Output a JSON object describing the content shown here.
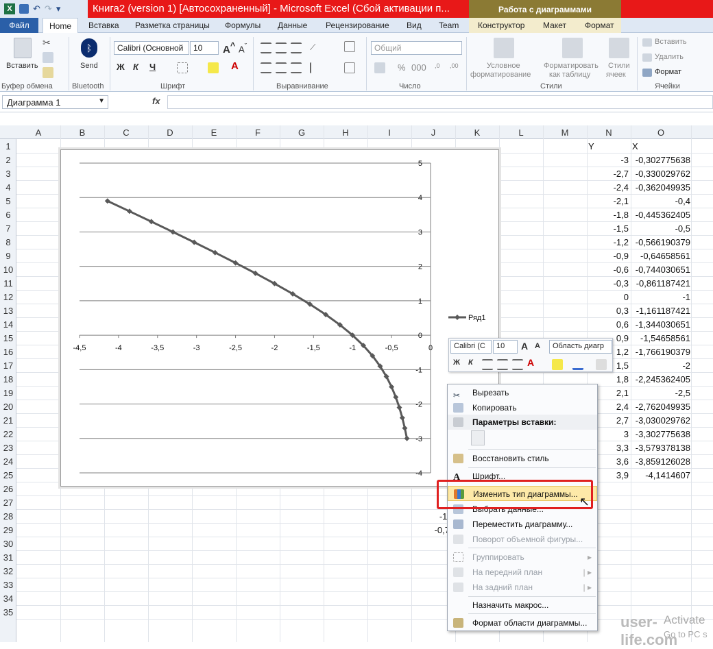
{
  "window": {
    "title": "Книга2 (version 1) [Автосохраненный]  -  Microsoft Excel (Сбой активации п...",
    "context_tab_title": "Работа с диаграммами"
  },
  "tabs": [
    {
      "label": "Файл"
    },
    {
      "label": "Home"
    },
    {
      "label": "Вставка"
    },
    {
      "label": "Разметка страницы"
    },
    {
      "label": "Формулы"
    },
    {
      "label": "Данные"
    },
    {
      "label": "Рецензирование"
    },
    {
      "label": "Вид"
    },
    {
      "label": "Team"
    },
    {
      "label": "Конструктор"
    },
    {
      "label": "Макет"
    },
    {
      "label": "Формат"
    }
  ],
  "ribbon": {
    "paste_label": "Вставить",
    "send_label": "Send",
    "font_name": "Calibri (Основной",
    "font_size": "10",
    "number_format": "Общий",
    "cond_format_line1": "Условное",
    "cond_format_line2": "форматирование",
    "table_format_line1": "Форматировать",
    "table_format_line2": "как таблицу",
    "cell_styles_line1": "Стили",
    "cell_styles_line2": "ячеек",
    "insert_label": "Вставить",
    "delete_label": "Удалить",
    "format_label": "Формат",
    "groups": {
      "clipboard": "Буфер обмена",
      "bluetooth": "Bluetooth",
      "font": "Шрифт",
      "alignment": "Выравнивание",
      "number": "Число",
      "styles": "Стили",
      "cells": "Ячейки"
    }
  },
  "formula_bar": {
    "name_box": "Диаграмма 1",
    "fx": "fx"
  },
  "columns": [
    "A",
    "B",
    "C",
    "D",
    "E",
    "F",
    "G",
    "H",
    "I",
    "J",
    "K",
    "L",
    "M",
    "N",
    "O"
  ],
  "rows": [
    "1",
    "2",
    "3",
    "4",
    "5",
    "6",
    "7",
    "8",
    "9",
    "10",
    "11",
    "12",
    "13",
    "14",
    "15",
    "16",
    "17",
    "18",
    "19",
    "20",
    "21",
    "22",
    "23",
    "24",
    "25",
    "26",
    "27",
    "28",
    "29",
    "30",
    "31",
    "32",
    "33",
    "34",
    "35"
  ],
  "sheet": {
    "header_y": "Y",
    "header_x": "X",
    "y_values": [
      "-3",
      "-2,7",
      "-2,4",
      "-2,1",
      "-1,8",
      "-1,5",
      "-1,2",
      "-0,9",
      "-0,6",
      "-0,3",
      "0",
      "0,3",
      "0,6",
      "0,9",
      "1,2",
      "1,5",
      "1,8",
      "2,1",
      "2,4",
      "2,7",
      "3",
      "3,3",
      "3,6",
      "3,9"
    ],
    "x_values": [
      "-0,302775638",
      "-0,330029762",
      "-0,362049935",
      "-0,4",
      "-0,445362405",
      "-0,5",
      "-0,566190379",
      "-0,64658561",
      "-0,744030651",
      "-0,861187421",
      "-1",
      "-1,161187421",
      "-1,344030651",
      "-1,54658561",
      "-1,766190379",
      "-2",
      "-2,245362405",
      "-2,5",
      "-2,762049935",
      "-3,030029762",
      "-3,302775638",
      "-3,579378138",
      "-3,859126028",
      "-4,1414607"
    ],
    "partial_cells": [
      "-1,",
      "-0,7"
    ]
  },
  "chart_data": {
    "type": "scatter",
    "series": [
      {
        "name": "Ряд1",
        "x": [
          -0.302775638,
          -0.330029762,
          -0.362049935,
          -0.4,
          -0.445362405,
          -0.5,
          -0.566190379,
          -0.64658561,
          -0.744030651,
          -0.861187421,
          -1,
          -1.161187421,
          -1.344030651,
          -1.54658561,
          -1.766190379,
          -2,
          -2.245362405,
          -2.5,
          -2.762049935,
          -3.030029762,
          -3.302775638,
          -3.579378138,
          -3.859126028,
          -4.1414607
        ],
        "y": [
          -3,
          -2.7,
          -2.4,
          -2.1,
          -1.8,
          -1.5,
          -1.2,
          -0.9,
          -0.6,
          -0.3,
          0,
          0.3,
          0.6,
          0.9,
          1.2,
          1.5,
          1.8,
          2.1,
          2.4,
          2.7,
          3,
          3.3,
          3.6,
          3.9
        ]
      }
    ],
    "xlim": [
      -4.5,
      0
    ],
    "ylim": [
      -4,
      5
    ],
    "x_ticks": [
      "-4,5",
      "-4",
      "-3,5",
      "-3",
      "-2,5",
      "-2",
      "-1,5",
      "-1",
      "-0,5",
      "0"
    ],
    "y_ticks": [
      "5",
      "4",
      "3",
      "2",
      "1",
      "0",
      "-1",
      "-2",
      "-3",
      "-4"
    ],
    "grid": "horizontal",
    "legend": "right",
    "colors": {
      "line": "#595959"
    }
  },
  "mini_toolbar": {
    "font": "Calibri (С",
    "size": "10",
    "area": "Область диагр"
  },
  "context_menu": {
    "cut": "Вырезать",
    "copy": "Копировать",
    "paste_options": "Параметры вставки:",
    "reset_style": "Восстановить стиль",
    "font": "Шрифт...",
    "change_type": "Изменить тип диаграммы...",
    "select_data": "Выбрать данные...",
    "move_chart": "Переместить диаграмму...",
    "rotate_3d": "Поворот объемной фигуры...",
    "group": "Группировать",
    "bring_front": "На передний план",
    "send_back": "На задний план",
    "assign_macro": "Назначить макрос...",
    "format_area": "Формат области диаграммы..."
  },
  "overlay": {
    "watermark": "user-life.com",
    "activate": "Activate",
    "goto": "Go to PC s"
  }
}
